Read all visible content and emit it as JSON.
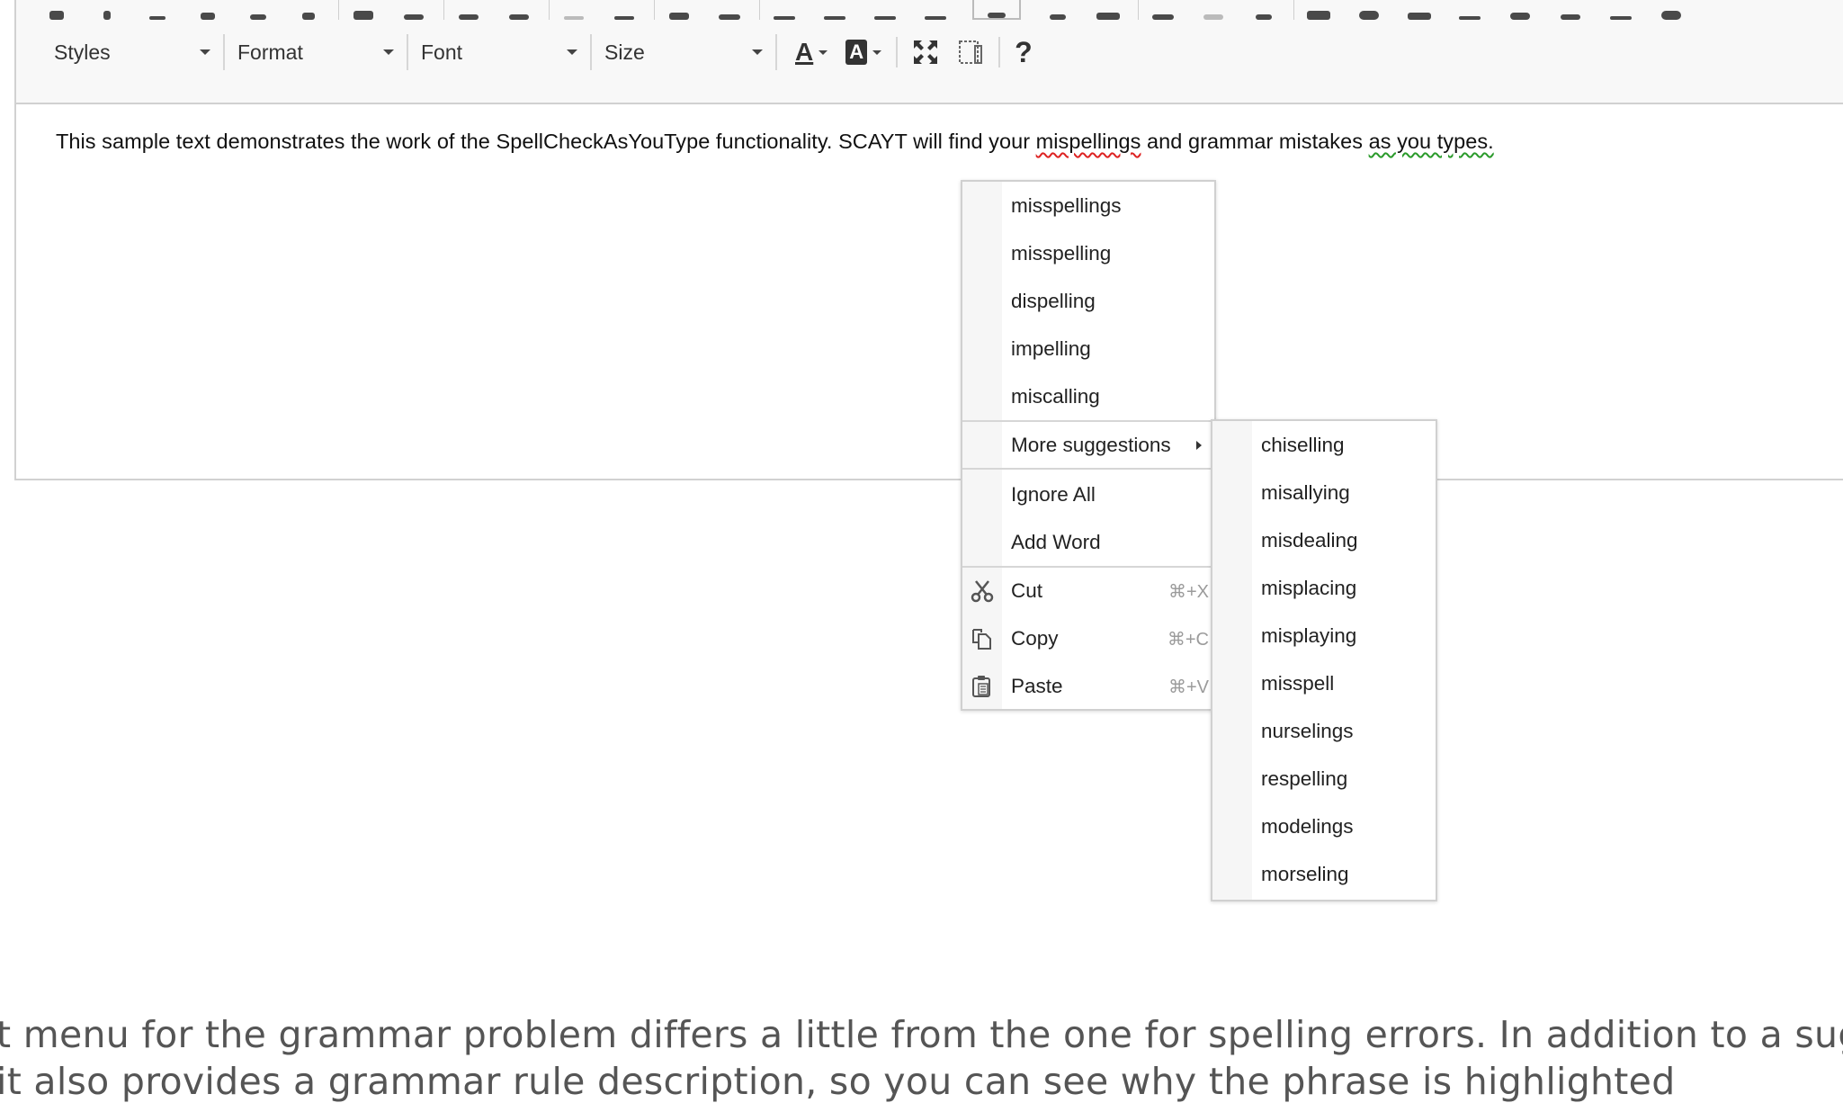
{
  "toolbar": {
    "styles_label": "Styles",
    "format_label": "Format",
    "font_label": "Font",
    "size_label": "Size",
    "text_color_label": "A",
    "bg_color_label": "A",
    "help_label": "?"
  },
  "editor": {
    "text_before": "This sample text demonstrates the work of the SpellCheckAsYouType functionality. SCAYT will find your ",
    "misspelled_word": "mispellings",
    "text_middle": " and grammar mistakes ",
    "grammar_error": "as you types.",
    "text_after": ""
  },
  "context_menu": {
    "suggestions": [
      "misspellings",
      "misspelling",
      "dispelling",
      "impelling",
      "miscalling"
    ],
    "more_suggestions_label": "More suggestions",
    "ignore_all_label": "Ignore All",
    "add_word_label": "Add Word",
    "cut": {
      "label": "Cut",
      "shortcut": "⌘+X",
      "icon": "scissors-icon"
    },
    "copy": {
      "label": "Copy",
      "shortcut": "⌘+C",
      "icon": "copy-icon"
    },
    "paste": {
      "label": "Paste",
      "shortcut": "⌘+V",
      "icon": "paste-icon"
    }
  },
  "more_suggestions": [
    "chiselling",
    "misallying",
    "misdealing",
    "misplacing",
    "misplaying",
    "misspell",
    "nurselings",
    "respelling",
    "modelings",
    "morseling"
  ],
  "article": {
    "line1": "t menu for the grammar problem differs a little from the one for spelling errors. In addition to a sug",
    "line2": "it also provides a grammar rule description, so you can see why the phrase is highlighted"
  },
  "colors": {
    "spelling_underline": "#dd2222",
    "grammar_underline": "#2a9a2a",
    "menu_border": "#d0d0d0",
    "shortcut_text": "#9b9b9b"
  }
}
